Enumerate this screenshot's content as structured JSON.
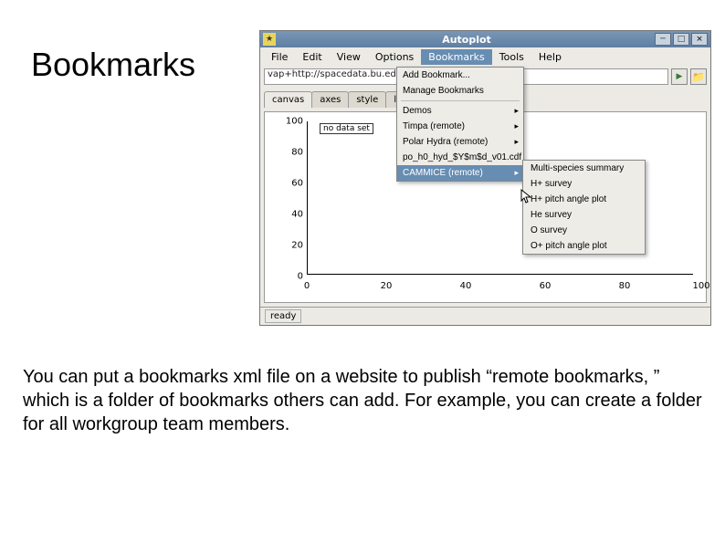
{
  "slide": {
    "title": "Bookmarks",
    "body": "You can put a bookmarks xml file on a website to publish “remote bookmarks, ” which is a folder of bookmarks others can add.  For example, you can create a folder for all workgroup team members."
  },
  "window": {
    "title": "Autoplot",
    "menus": [
      "File",
      "Edit",
      "View",
      "Options",
      "Bookmarks",
      "Tools",
      "Help"
    ],
    "active_menu": "Bookmarks",
    "address": "vap+http://spacedata.bu.edu/_$Y$m$d_v..cdf?HFlu",
    "tabs": [
      "canvas",
      "axes",
      "style",
      "layout"
    ],
    "active_tab": "canvas",
    "status": "ready",
    "no_data_label": "no data set"
  },
  "dropdown": {
    "add": "Add Bookmark...",
    "manage": "Manage Bookmarks",
    "items": [
      {
        "label": "Demos"
      },
      {
        "label": "Timpa (remote)"
      },
      {
        "label": "Polar Hydra (remote)"
      },
      {
        "label": "po_h0_hyd_$Y$m$d_v01.cdf"
      },
      {
        "label": "CAMMICE (remote)"
      }
    ]
  },
  "submenu": {
    "items": [
      "Multi-species summary",
      "H+ survey",
      "H+ pitch angle plot",
      "He survey",
      "O survey",
      "O+ pitch angle plot"
    ]
  },
  "chart_data": {
    "type": "line",
    "title": "",
    "xlabel": "",
    "ylabel": "",
    "y_ticks": [
      0,
      20,
      40,
      60,
      80,
      100
    ],
    "x_ticks": [
      0,
      20,
      40,
      60,
      80,
      100
    ],
    "xlim": [
      0,
      100
    ],
    "ylim": [
      0,
      100
    ],
    "series": []
  }
}
